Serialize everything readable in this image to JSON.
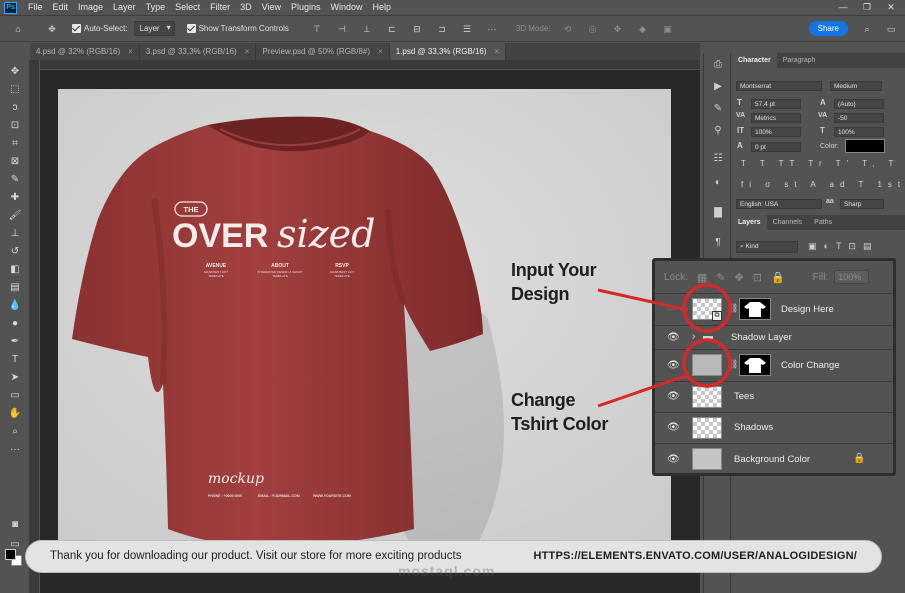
{
  "app": {
    "logo": "Ps",
    "menu": [
      "File",
      "Edit",
      "Image",
      "Layer",
      "Type",
      "Select",
      "Filter",
      "3D",
      "View",
      "Plugins",
      "Window",
      "Help"
    ]
  },
  "window_controls": {
    "minimize": "—",
    "restore": "❐",
    "close": "✕"
  },
  "options_bar": {
    "auto_select_label": "Auto-Select:",
    "auto_select_value": "Layer",
    "transform_label": "Show Transform Controls",
    "mode_3d_label": "3D Mode:",
    "share_label": "Share"
  },
  "tabs": [
    {
      "label": "4.psd @ 32% (RGB/16)",
      "close": "×"
    },
    {
      "label": "3.psd @ 33,3% (RGB/16)",
      "close": "×"
    },
    {
      "label": "Preview.psd @ 50% (RGB/8#)",
      "close": "×"
    },
    {
      "label": "1.psd @ 33,3% (RGB/16)",
      "close": "×"
    }
  ],
  "tshirt": {
    "badge": "THE",
    "headline_bold": "OVER",
    "headline_script": "sized",
    "cols": [
      {
        "title": "AVENUE",
        "body1": "GRAB BEST LIFT",
        "body2": "TEMPLATE"
      },
      {
        "title": "ABOUT",
        "body1": "INTEGRATED DESIGN & SMART",
        "body2": "TEMPLATE"
      },
      {
        "title": "RSVP",
        "body1": "GRAB BEST LIFT",
        "body2": "TEMPLATE"
      }
    ],
    "mockup": "mockup",
    "footer": [
      "PHONE : +0000 0000",
      "EMAIL : YOURMAIL.COM",
      "WWW.YOURSITE.COM"
    ]
  },
  "character_panel": {
    "tabs": [
      "Character",
      "Paragraph"
    ],
    "font_family": "Montserrat",
    "font_style": "Medium",
    "size": "57,4 pt",
    "leading": "(Auto)",
    "kerning": "Metrics",
    "tracking": "-50",
    "vscale": "100%",
    "hscale": "100%",
    "baseline": "0 pt",
    "color_label": "Color:",
    "language": "English: USA",
    "antialias": "Sharp",
    "typo_row": "T T TT Tr T' T, T T",
    "ot_row": "fi σ st A ad T 1st ½"
  },
  "layers_panel": {
    "tabs": [
      "Layers",
      "Channels",
      "Paths"
    ],
    "kind_label": "Kind"
  },
  "inset": {
    "lock_label": "Lock:",
    "fill_label": "Fill:",
    "fill_value": "100%",
    "layers": [
      {
        "name": "Design Here",
        "visible": false
      },
      {
        "name": "Shadow Layer",
        "visible": true,
        "group": true
      },
      {
        "name": "Color Change",
        "visible": true
      },
      {
        "name": "Tees",
        "visible": true
      },
      {
        "name": "Shadows",
        "visible": true
      },
      {
        "name": "Background Color",
        "visible": true,
        "locked": true
      }
    ]
  },
  "annotations": {
    "input_line1": "Input Your",
    "input_line2": "Design",
    "change_line1": "Change",
    "change_line2": "Tshirt Color"
  },
  "banner": {
    "message": "Thank you for downloading our product. Visit our store for more exciting products",
    "url": "HTTPS://ELEMENTS.ENVATO.COM/USER/ANALOGIDESIGN/"
  },
  "watermark": "mostaql.com",
  "colors": {
    "shirt": "#9b3a3a",
    "annotation_red": "#d42a2a",
    "share_blue": "#1473e6",
    "panel_bg": "#535353"
  }
}
